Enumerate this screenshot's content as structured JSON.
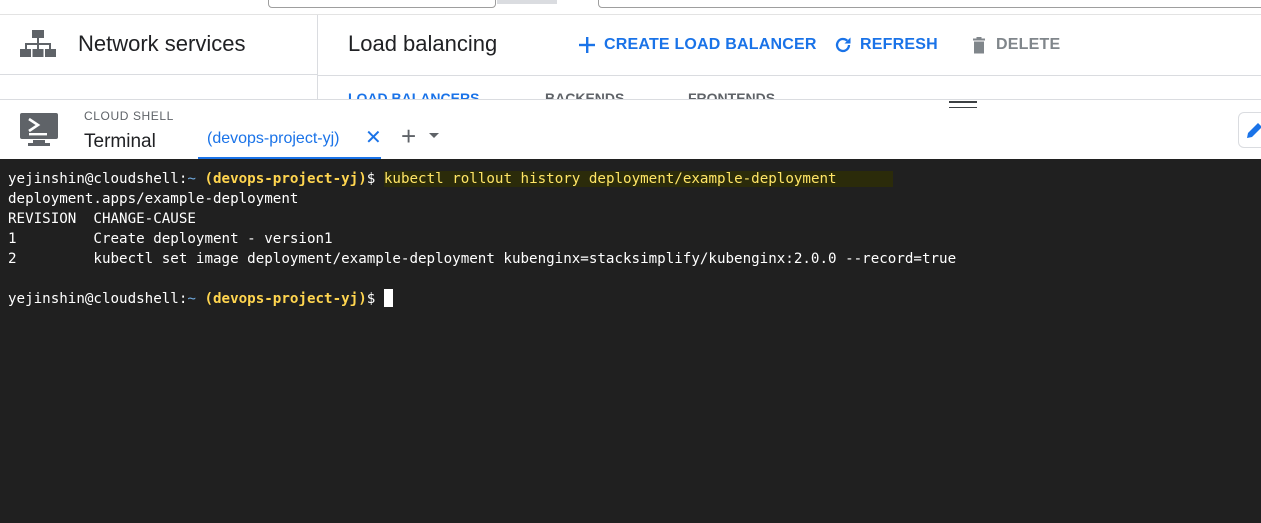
{
  "console": {
    "product_title": "Network services",
    "page_title": "Load balancing",
    "actions": {
      "create": "CREATE LOAD BALANCER",
      "refresh": "REFRESH",
      "delete": "DELETE"
    },
    "tabs": [
      "LOAD BALANCERS",
      "BACKENDS",
      "FRONTENDS"
    ]
  },
  "cloud_shell": {
    "caption": "CLOUD SHELL",
    "terminal_label": "Terminal",
    "active_tab": "(devops-project-yj)",
    "close_glyph": "✕",
    "add_glyph": "+"
  },
  "terminal": {
    "prompt_user": "yejinshin@cloudshell:",
    "prompt_tilde": "~",
    "prompt_project": "(devops-project-yj)",
    "prompt_symbol": "$",
    "command": "kubectl rollout history deployment/example-deployment",
    "output": [
      "deployment.apps/example-deployment",
      "REVISION  CHANGE-CAUSE",
      "1         Create deployment - version1",
      "2         kubectl set image deployment/example-deployment kubenginx=stacksimplify/kubenginx:2.0.0 --record=true"
    ]
  },
  "colors": {
    "accent": "#1a73e8",
    "terminal_bg": "#202020",
    "project_highlight": "#ffd54f",
    "command_text": "#ffe566"
  },
  "icons": [
    "network-services-icon",
    "add-icon",
    "refresh-icon",
    "trash-icon",
    "cloud-shell-icon",
    "close-icon",
    "add-tab-icon",
    "chevron-down-icon",
    "edit-icon"
  ]
}
